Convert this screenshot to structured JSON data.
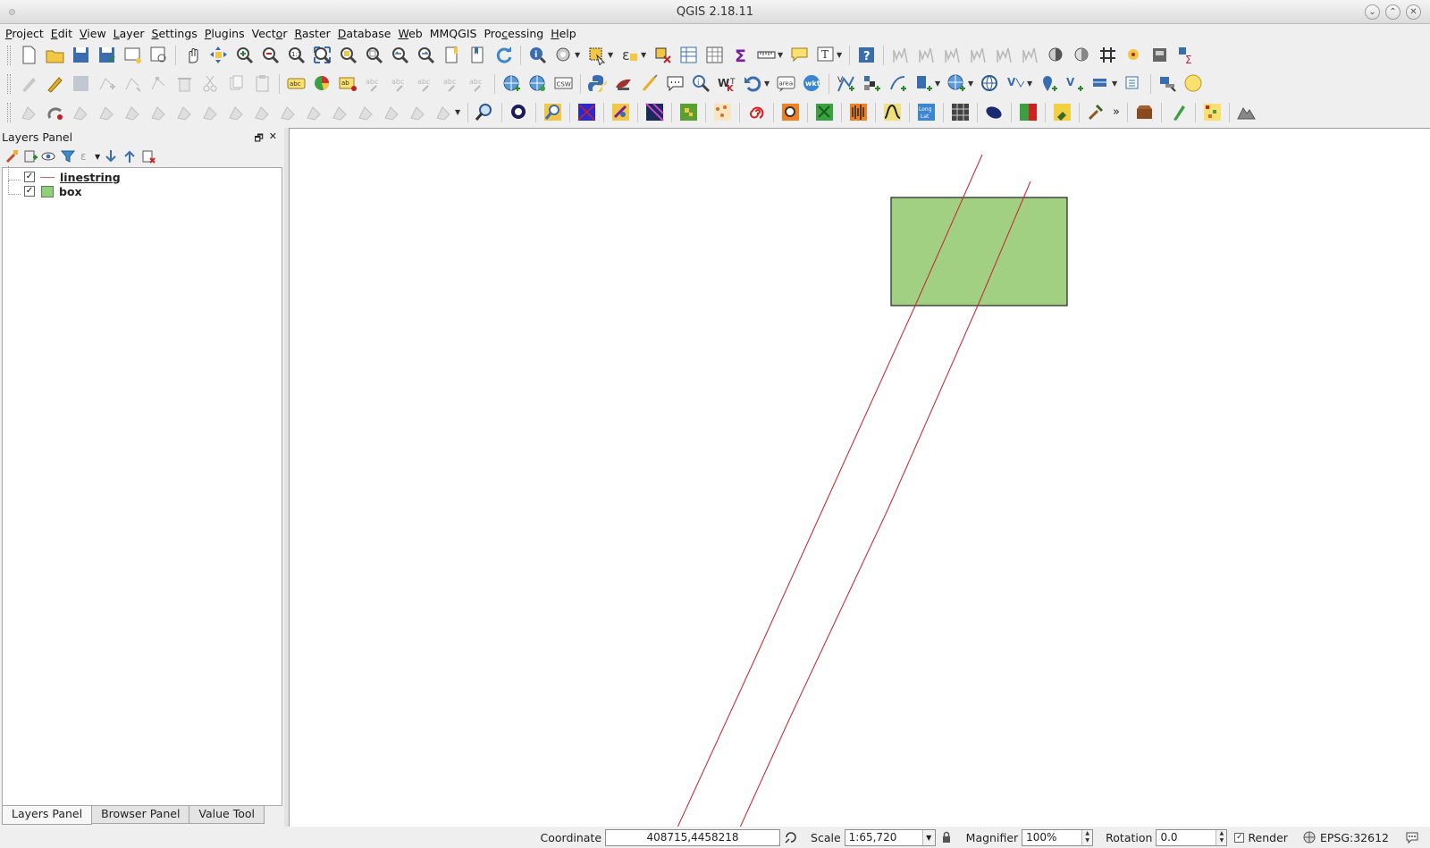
{
  "window": {
    "title": "QGIS 2.18.11"
  },
  "menu": [
    {
      "label": "Project",
      "u": "P"
    },
    {
      "label": "Edit",
      "u": "E"
    },
    {
      "label": "View",
      "u": "V"
    },
    {
      "label": "Layer",
      "u": "L"
    },
    {
      "label": "Settings",
      "u": "S"
    },
    {
      "label": "Plugins",
      "u": "P"
    },
    {
      "label": "Vector",
      "u": "o"
    },
    {
      "label": "Raster",
      "u": "R"
    },
    {
      "label": "Database",
      "u": "D"
    },
    {
      "label": "Web",
      "u": "W"
    },
    {
      "label": "MMQGIS",
      "u": ""
    },
    {
      "label": "Processing",
      "u": "c"
    },
    {
      "label": "Help",
      "u": "H"
    }
  ],
  "layers_panel": {
    "title": "Layers Panel",
    "layers": [
      {
        "name": "linestring",
        "checked": true,
        "symbol": "line",
        "color": "#e05a5a"
      },
      {
        "name": "box",
        "checked": true,
        "symbol": "polygon",
        "color": "#8fd07c"
      }
    ],
    "tabs": [
      "Layers Panel",
      "Browser Panel",
      "Value Tool"
    ]
  },
  "map": {
    "box_fill": "#a1d082",
    "box_stroke": "#222222",
    "line_color": "#c4303a"
  },
  "statusbar": {
    "coordinate_label": "Coordinate",
    "coordinate_value": "408715,4458218",
    "scale_label": "Scale",
    "scale_value": "1:65,720",
    "magnifier_label": "Magnifier",
    "magnifier_value": "100%",
    "rotation_label": "Rotation",
    "rotation_value": "0.0",
    "render_label": "Render",
    "render_checked": true,
    "crs": "EPSG:32612"
  }
}
